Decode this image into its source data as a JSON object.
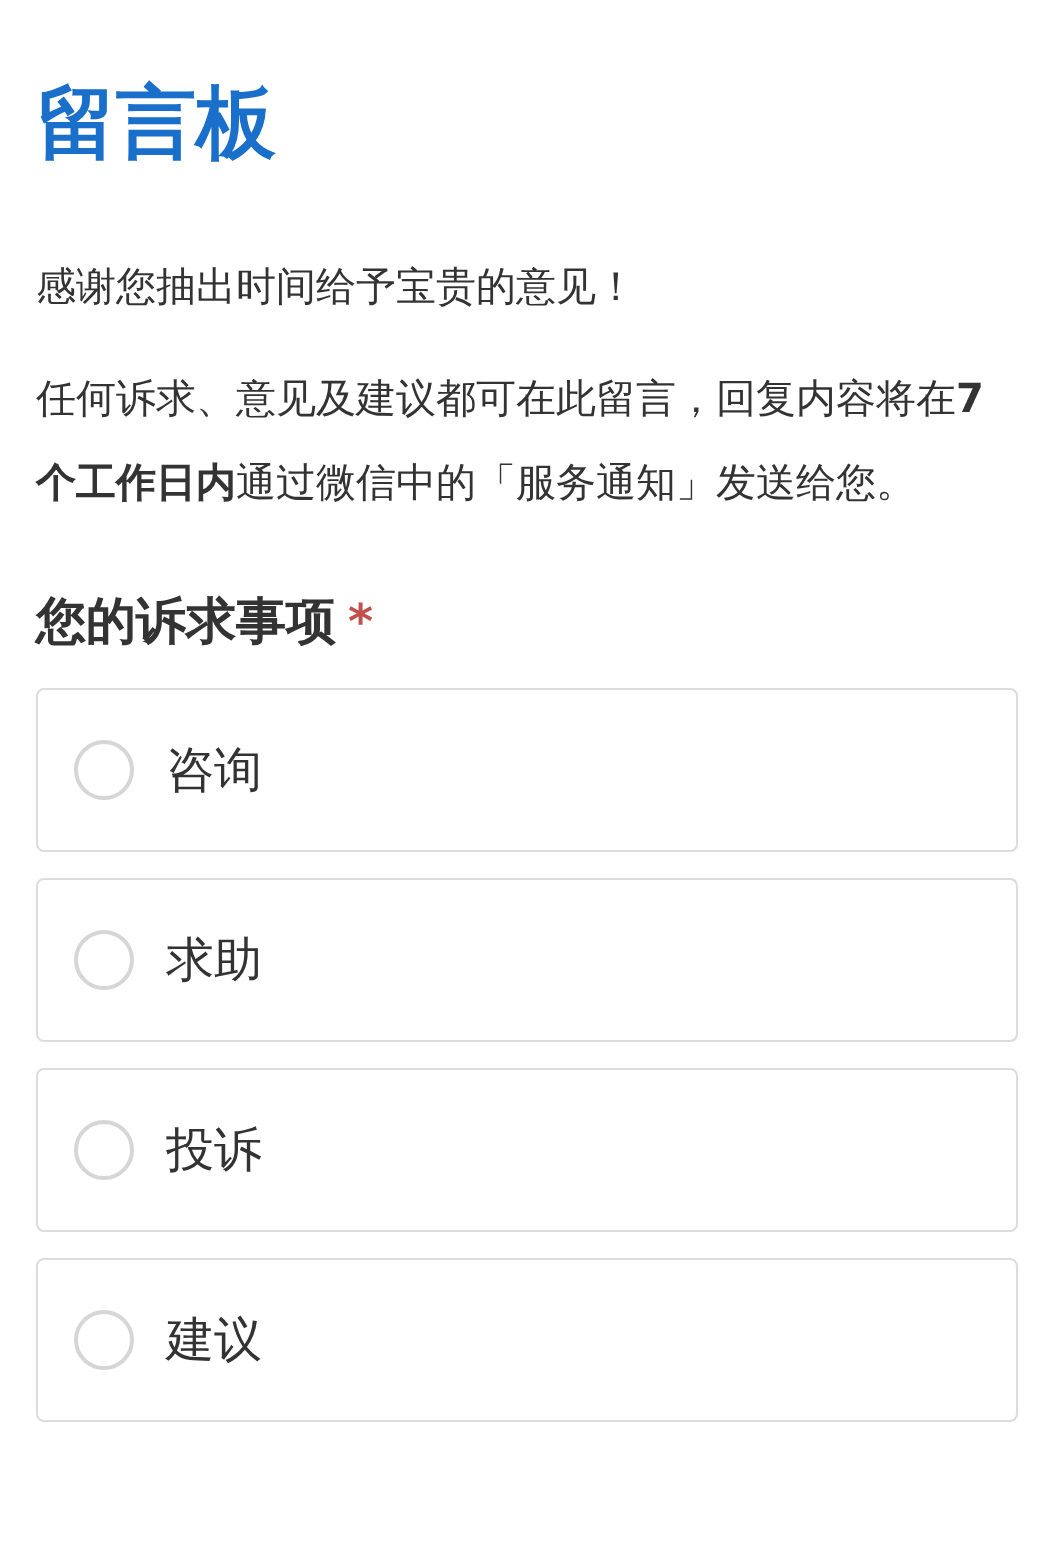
{
  "title": "留言板",
  "paragraphs": [
    "感谢您抽出时间给予宝贵的意见！",
    "任何诉求、意见及建议都可在此留言，回复内容将在**7 个工作日内**通过微信中的「服务通知」发送给您。"
  ],
  "question": {
    "label": "您的诉求事项",
    "required_mark": "*",
    "required": true,
    "options": [
      {
        "label": "咨询",
        "selected": false
      },
      {
        "label": "求助",
        "selected": false
      },
      {
        "label": "投诉",
        "selected": false
      },
      {
        "label": "建议",
        "selected": false
      }
    ]
  }
}
